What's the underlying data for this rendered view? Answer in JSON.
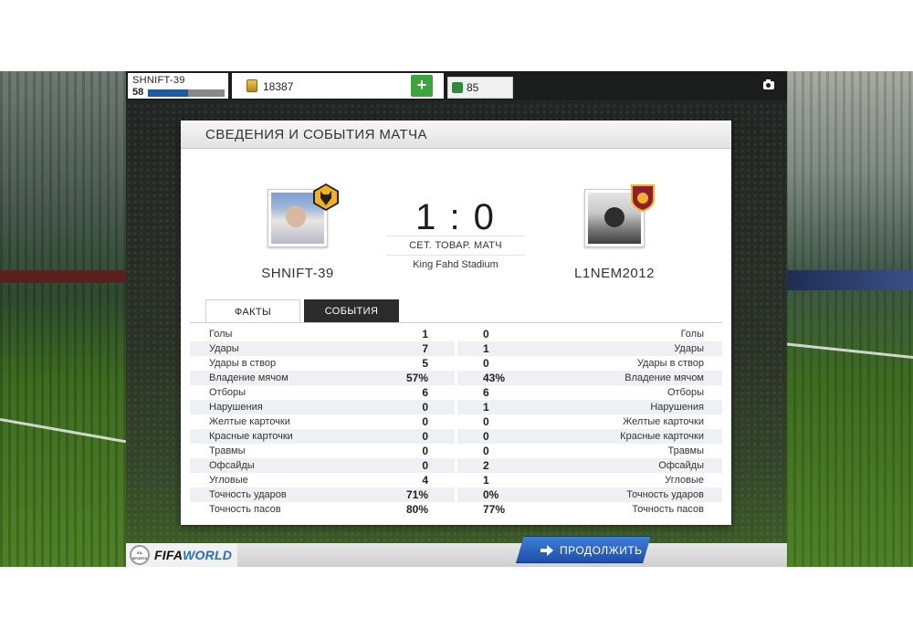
{
  "header": {
    "username": "SHNIFT-39",
    "level": "58",
    "xp_progress": 0.52,
    "coins": "18387",
    "fifa_points": "85",
    "add_label": "+"
  },
  "panel": {
    "title": "СВЕДЕНИЯ И СОБЫТИЯ МАТЧА"
  },
  "match": {
    "home_name": "SHNIFT-39",
    "away_name": "L1NEM2012",
    "score": "1 : 0",
    "type": "СЕТ. ТОВАР. МАТЧ",
    "stadium": "King Fahd Stadium"
  },
  "tabs": {
    "facts": "ФАКТЫ",
    "events": "СОБЫТИЯ"
  },
  "stats": [
    {
      "label": "Голы",
      "home": "1",
      "away": "0"
    },
    {
      "label": "Удары",
      "home": "7",
      "away": "1"
    },
    {
      "label": "Удары в створ",
      "home": "5",
      "away": "0"
    },
    {
      "label": "Владение мячом",
      "home": "57%",
      "away": "43%"
    },
    {
      "label": "Отборы",
      "home": "6",
      "away": "6"
    },
    {
      "label": "Нарушения",
      "home": "0",
      "away": "1"
    },
    {
      "label": "Желтые карточки",
      "home": "0",
      "away": "0"
    },
    {
      "label": "Красные карточки",
      "home": "0",
      "away": "0"
    },
    {
      "label": "Травмы",
      "home": "0",
      "away": "0"
    },
    {
      "label": "Офсайды",
      "home": "0",
      "away": "2"
    },
    {
      "label": "Угловые",
      "home": "4",
      "away": "1"
    },
    {
      "label": "Точность ударов",
      "home": "71%",
      "away": "0%"
    },
    {
      "label": "Точность пасов",
      "home": "80%",
      "away": "77%"
    }
  ],
  "footer": {
    "logo_ea": "EA SPORTS",
    "logo_fifa": "FIFA",
    "logo_world": "WORLD",
    "continue_label": "ПРОДОЛЖИТЬ"
  },
  "icons": {
    "coin": "coin-icon",
    "points": "points-icon",
    "camera": "camera-icon",
    "continue": "arrow-right-icon"
  }
}
